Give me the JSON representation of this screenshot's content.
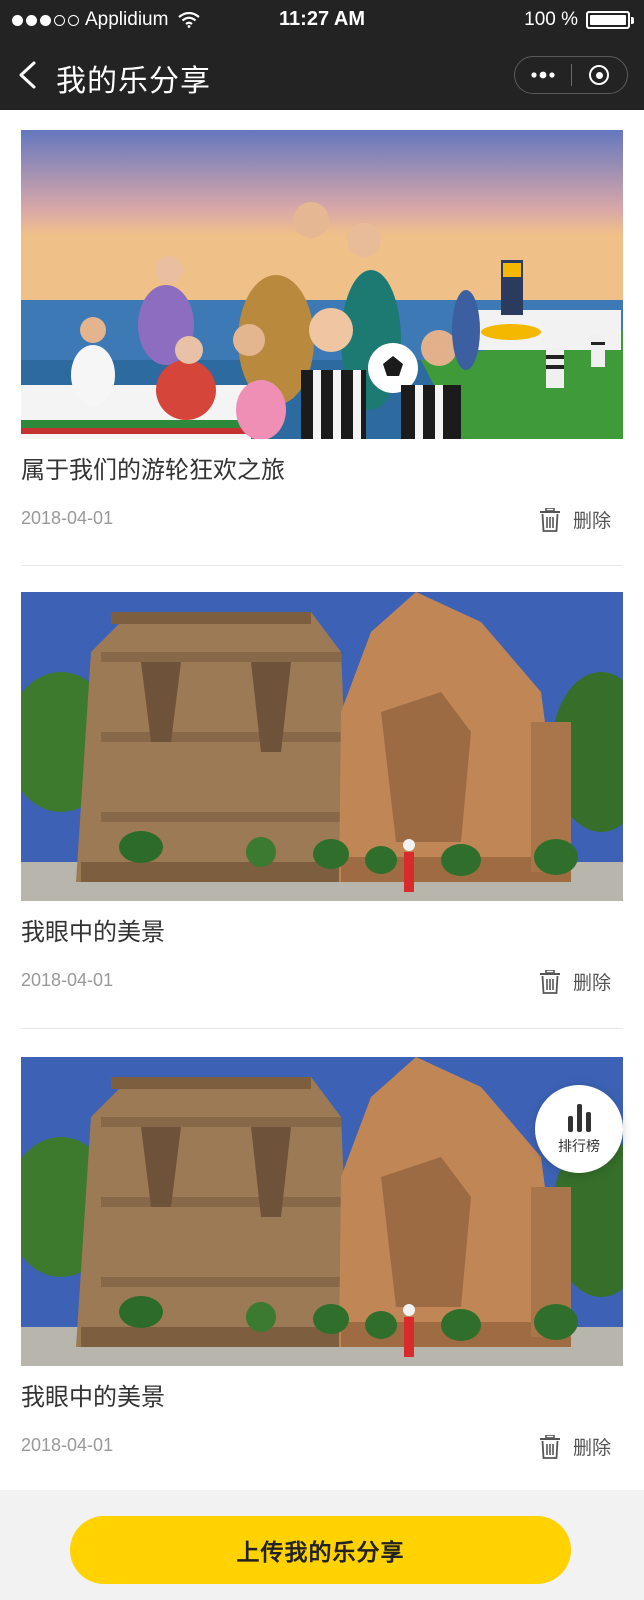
{
  "status_bar": {
    "carrier": "Applidium",
    "time": "11:27 AM",
    "battery_percent": "100 %",
    "battery_level": 1.0
  },
  "nav": {
    "title": "我的乐分享"
  },
  "cards": [
    {
      "title": "属于我们的游轮狂欢之旅",
      "date": "2018-04-01",
      "delete_label": "删除",
      "image": "cruise-party-photo"
    },
    {
      "title": "我眼中的美景",
      "date": "2018-04-01",
      "delete_label": "删除",
      "image": "ancient-brick-temple-photo"
    },
    {
      "title": "我眼中的美景",
      "date": "2018-04-01",
      "delete_label": "删除",
      "image": "ancient-brick-temple-photo"
    }
  ],
  "ranking": {
    "label": "排行榜"
  },
  "upload": {
    "label": "上传我的乐分享"
  },
  "colors": {
    "nav_bg": "#232323",
    "accent": "#ffd200",
    "bottom_bg": "#f2f2f2"
  }
}
